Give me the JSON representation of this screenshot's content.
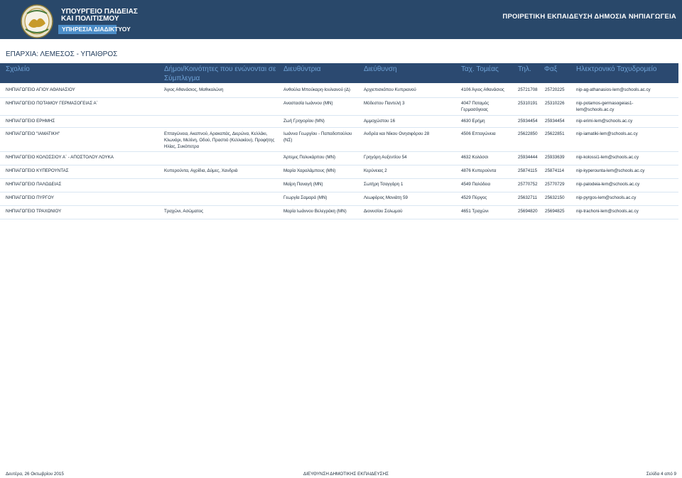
{
  "header": {
    "ministry_line1": "ΥΠΟΥΡΓΕΙΟ ΠΑΙΔΕΙΑΣ",
    "ministry_line2": "ΚΑΙ ΠΟΛΙΤΙΣΜΟΥ",
    "service": "ΥΠΗΡΕΣΙΑ ΔΙΑΔΙΚΤΥΟΥ",
    "directorate_title": "ΠΡΟΙΡΕΤΙΚΗ ΕΚΠΑΙΔΕΥΣΗ ΔΗΜΟΣΙΑ ΝΗΠΙΑΓΩΓΕΙΑ",
    "district": "ΕΠΑΡΧΙΑ:  ΛΕΜΕΣΟΣ - ΥΠΑΙΘΡΟΣ",
    "banner_color": "#29486a",
    "accent_color": "#4c8ec9"
  },
  "columns": {
    "school": "Σχολείο",
    "communities": "Δήμοι/Κοινότητες που ενώνονται σε Σύμπλεγμα",
    "principal": "Διευθύντρια",
    "address": "Διεύθυνση",
    "postal": "Ταχ. Τομέας",
    "phone": "Τηλ.",
    "fax": "Φαξ",
    "email": "Ηλεκτρονικό Ταχυδρομείο"
  },
  "rows": [
    {
      "school": "ΝΗΠΙΑΓΩΓΕΙΟ ΑΓΙΟΥ ΑΘΑΝΑΣΙΟΥ",
      "communities": "Άγιος Αθανάσιος, Μαθικολώνη",
      "principal": "Ανθούλα Μπούκαρη-Ιουλιανού (Δ)",
      "address": "Αρχιεπισκόπου Κυπριανού",
      "postal": "4106 Άγιος Αθανάσιος",
      "phone": "25721708",
      "fax": "25720225",
      "email": "nip-ag-athanasios-lem@schools.ac.cy"
    },
    {
      "school": "ΝΗΠΙΑΓΩΓΕΙΟ ΠΟΤΑΜΟΥ ΓΕΡΜΑΣΟΓΕΙΑΣ Α΄",
      "communities": "",
      "principal": "Αναστασία Ιωάννου (ΜΝ)",
      "address": "Μόδεστου Παντελή 3",
      "postal": "4047 Ποταμός Γερμασόγειας",
      "phone": "25310191",
      "fax": "25310226",
      "email": "nip-potamos-germasogeias1-lem@schools.ac.cy"
    },
    {
      "school": "ΝΗΠΙΑΓΩΓΕΙΟ ΕΡΗΜΗΣ",
      "communities": "",
      "principal": "Ζωή Γρηγορίου (ΜΝ)",
      "address": "Αμμοχώστου 16",
      "postal": "4630 Ερήμη",
      "phone": "25934454",
      "fax": "25934454",
      "email": "nip-erimi-lem@schools.ac.cy"
    },
    {
      "school": "ΝΗΠΙΑΓΩΓΕΙΟ \"ΙΑΜΑΤΙΚΗ\"",
      "communities": "Επταγώνεια, Ακαπνού, Αρακαπάς, Διερώνα, Κελλάκι, Κλωνάρι, Μελίνη, Οδού, Πραστιό (Κελλακίου), Προφήτης Ηλίας, Συκόπετρα",
      "principal": "Ιωάννα Γεωργίου - Παπαδοπούλου (ΝΣ)",
      "address": "Ανδρέα και Νίκου Ονησιφόρου 28",
      "postal": "4506 Επταγώνεια",
      "phone": "25622850",
      "fax": "25622851",
      "email": "nip-iamatiki-lem@schools.ac.cy"
    },
    {
      "school": "ΝΗΠΙΑΓΩΓΕΙΟ ΚΟΛΟΣΣΙΟΥ Α΄ - ΑΠΟΣΤΟΛΟΥ ΛΟΥΚΑ",
      "communities": "",
      "principal": "Άρτεμις Πολυκάρπου (ΜΝ)",
      "address": "Γρηγόρη Αυξεντίου 54",
      "postal": "4632 Κολόσσι",
      "phone": "25934444",
      "fax": "25933639",
      "email": "nip-kolossi1-lem@schools.ac.cy"
    },
    {
      "school": "ΝΗΠΙΑΓΩΓΕΙΟ ΚΥΠΕΡΟΥΝΤΑΣ",
      "communities": "Κυπερούντα, Αγρίδια, Δύμες, Χανδριά",
      "principal": "Μαρία Χαραλάμπους (ΜΝ)",
      "address": "Κερύνειας 2",
      "postal": "4876 Κυπερούντα",
      "phone": "25874115",
      "fax": "25874114",
      "email": "nip-kyperounta-lem@schools.ac.cy"
    },
    {
      "school": "ΝΗΠΙΑΓΩΓΕΙΟ ΠΑΛΟΔΕΙΑΣ",
      "communities": "",
      "principal": "Μαίρη Παναγή (ΜΝ)",
      "address": "Σωτήρη Τσαγγάρη 1",
      "postal": "4549 Παλόδεια",
      "phone": "25770752",
      "fax": "25770729",
      "email": "nip-palodeia-lem@schools.ac.cy"
    },
    {
      "school": "ΝΗΠΙΑΓΩΓΕΙΟ ΠΥΡΓΟΥ",
      "communities": "",
      "principal": "Γεωργία Σαμαρά (ΜΝ)",
      "address": "Λεωφόρος Μονιάτη 59",
      "postal": "4529 Πύργος",
      "phone": "25632711",
      "fax": "25632150",
      "email": "nip-pyrgos-lem@schools.ac.cy"
    },
    {
      "school": "ΝΗΠΙΑΓΩΓΕΙΟ ΤΡΑΧΩΝΙΟΥ",
      "communities": "Τραχώνι, Ασώματος",
      "principal": "Μαρία Ιωάννου Βελεγράκη (ΜΝ)",
      "address": "Διονυσίου Σολωμού",
      "postal": "4651 Τραχώνι",
      "phone": "25694820",
      "fax": "25694825",
      "email": "nip-trachoni-lem@schools.ac.cy"
    }
  ],
  "footer": {
    "date": "Δευτέρα, 26 Οκτωβρίου 2015",
    "directorate": "ΔΙΕΥΘΥΝΣΗ ΔΗΜΟΤΙΚΗΣ ΕΚΠΑΙΔΕΥΣΗΣ",
    "page": "Σελίδα 4 από 9"
  }
}
